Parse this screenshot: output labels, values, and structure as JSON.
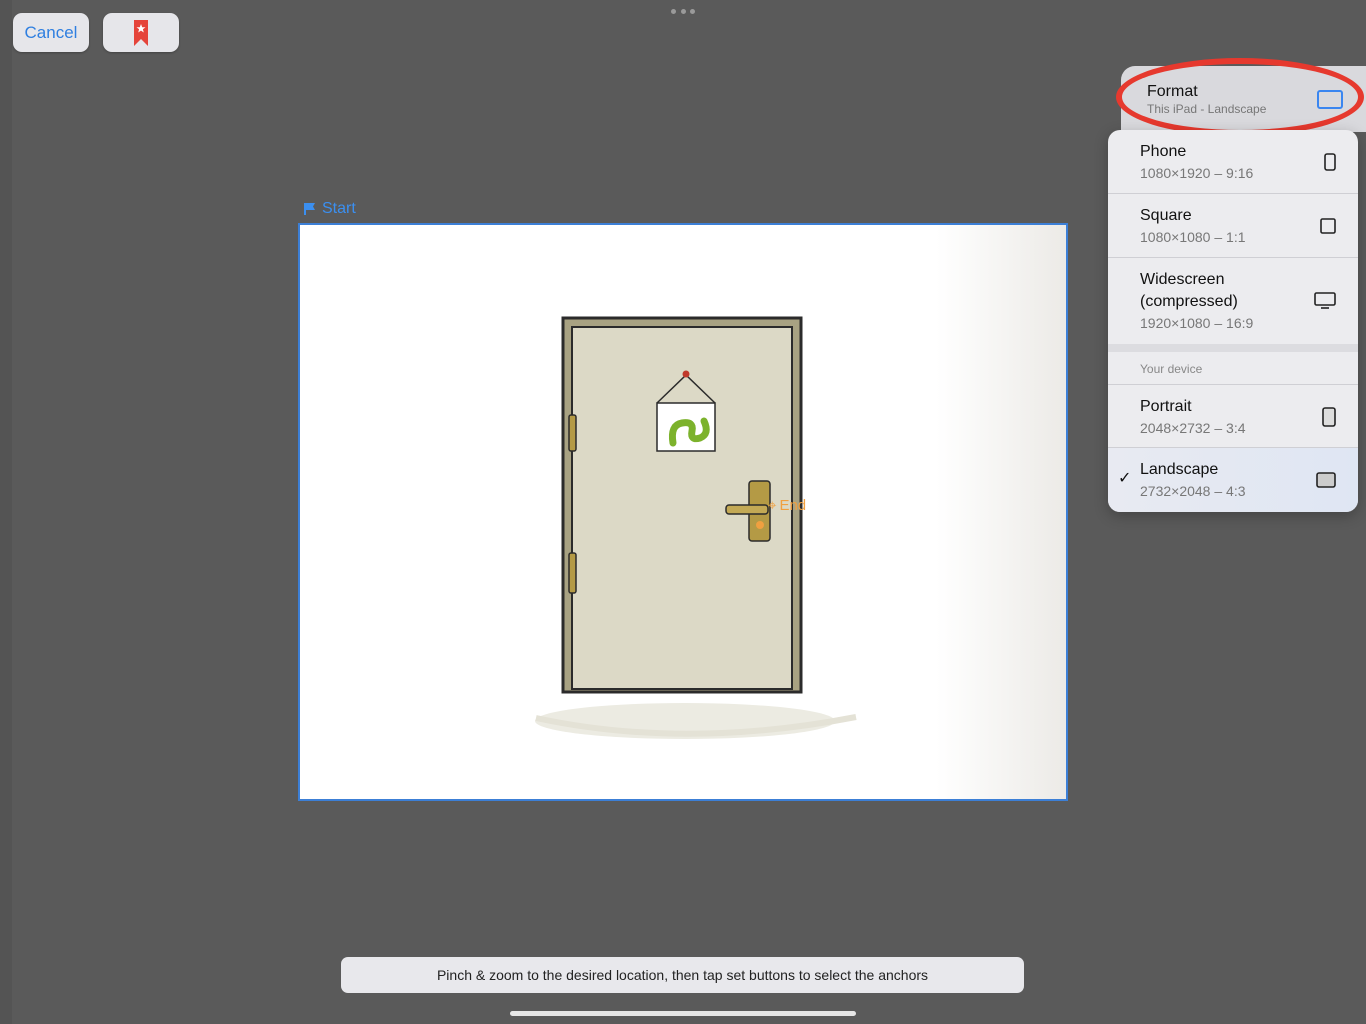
{
  "toolbar": {
    "cancel_label": "Cancel",
    "bookmark_icon": "bookmark-star-icon",
    "more_icon": "more-dots-icon"
  },
  "canvas": {
    "start_label": "Start",
    "end_label": "End",
    "illustration": "door-with-sign"
  },
  "hint": {
    "text": "Pinch & zoom to the desired location, then tap set buttons to select the anchors"
  },
  "format_popover": {
    "title": "Format",
    "subtitle": "This iPad - Landscape",
    "options": [
      {
        "name": "Phone",
        "dims": "1080×1920 – 9:16",
        "icon": "phone-icon"
      },
      {
        "name": "Square",
        "dims": "1080×1080 – 1:1",
        "icon": "square-icon"
      },
      {
        "name": "Widescreen\n(compressed)",
        "dims": "1920×1080 – 16:9",
        "icon": "monitor-icon"
      }
    ],
    "section_label": "Your device",
    "device_options": [
      {
        "name": "Portrait",
        "dims": "2048×2732 – 3:4",
        "icon": "tablet-portrait-icon"
      },
      {
        "name": "Landscape",
        "dims": "2732×2048 – 4:3",
        "icon": "tablet-landscape-icon",
        "selected": true
      }
    ],
    "check_mark": "✓"
  },
  "colors": {
    "accent": "#2f7fe0",
    "highlight": "#e6392e",
    "end_marker": "#f0a040"
  }
}
